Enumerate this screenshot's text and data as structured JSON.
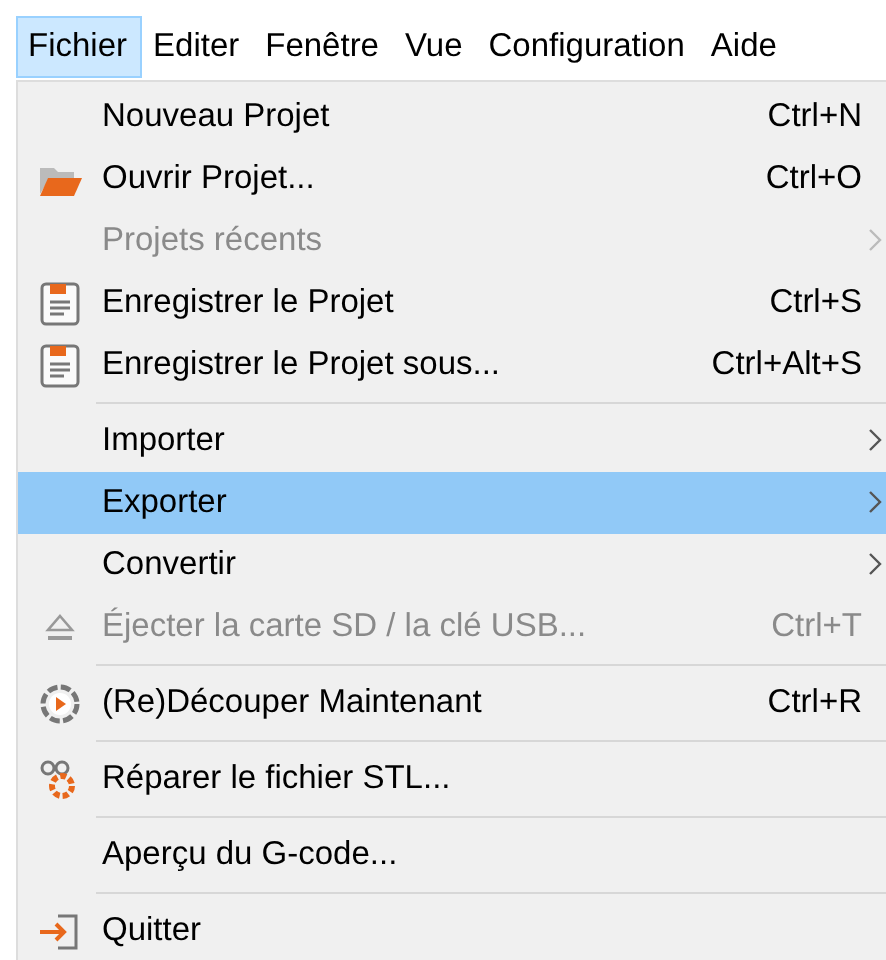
{
  "menubar": [
    {
      "label": "Fichier",
      "selected": true
    },
    {
      "label": "Editer",
      "selected": false
    },
    {
      "label": "Fenêtre",
      "selected": false
    },
    {
      "label": "Vue",
      "selected": false
    },
    {
      "label": "Configuration",
      "selected": false
    },
    {
      "label": "Aide",
      "selected": false
    }
  ],
  "menu": [
    {
      "kind": "plain",
      "label": "Nouveau Projet",
      "shortcut": "Ctrl+N",
      "disabled": false,
      "selected": false
    },
    {
      "kind": "folder",
      "label": "Ouvrir Projet...",
      "shortcut": "Ctrl+O",
      "disabled": false,
      "selected": false
    },
    {
      "kind": "plain",
      "label": "Projets récents",
      "submenu": true,
      "disabled": true,
      "selected": false
    },
    {
      "kind": "save",
      "label": "Enregistrer le Projet",
      "shortcut": "Ctrl+S",
      "disabled": false,
      "selected": false
    },
    {
      "kind": "save",
      "label": "Enregistrer le Projet sous...",
      "shortcut": "Ctrl+Alt+S",
      "disabled": false,
      "selected": false
    },
    {
      "kind": "separator"
    },
    {
      "kind": "plain",
      "label": "Importer",
      "submenu": true,
      "disabled": false,
      "selected": false
    },
    {
      "kind": "plain",
      "label": "Exporter",
      "submenu": true,
      "disabled": false,
      "selected": true
    },
    {
      "kind": "plain",
      "label": "Convertir",
      "submenu": true,
      "disabled": false,
      "selected": false
    },
    {
      "kind": "eject",
      "label": "Éjecter la carte SD / la clé USB...",
      "shortcut": "Ctrl+T",
      "disabled": true,
      "selected": false
    },
    {
      "kind": "separator"
    },
    {
      "kind": "slice",
      "label": "(Re)Découper Maintenant",
      "shortcut": "Ctrl+R",
      "disabled": false,
      "selected": false
    },
    {
      "kind": "separator"
    },
    {
      "kind": "repair",
      "label": "Réparer le fichier STL...",
      "disabled": false,
      "selected": false
    },
    {
      "kind": "separator"
    },
    {
      "kind": "plain",
      "label": "Aperçu du G-code...",
      "disabled": false,
      "selected": false
    },
    {
      "kind": "separator"
    },
    {
      "kind": "quit",
      "label": "Quitter",
      "disabled": false,
      "selected": false
    }
  ]
}
